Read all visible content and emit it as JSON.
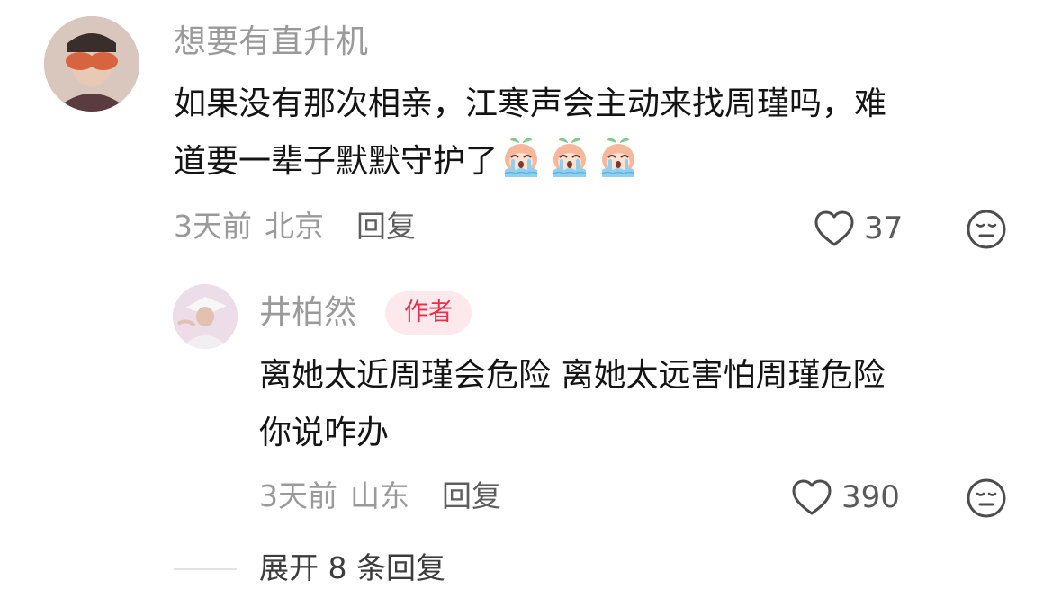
{
  "comment": {
    "username": "想要有直升机",
    "text_line1": "如果没有那次相亲，江寒声会主动来找周瑾吗，难",
    "text_line2": "道要一辈子默默守护了",
    "time": "3天前",
    "location": "北京",
    "reply_label": "回复",
    "likes": "37",
    "emoji": "crying-peach-emoji"
  },
  "reply": {
    "username": "井柏然",
    "badge": "作者",
    "text_line1": "离她太近周瑾会危险 离她太远害怕周瑾危险",
    "text_line2": "你说咋办",
    "time": "3天前",
    "location": "山东",
    "reply_label": "回复",
    "likes": "390"
  },
  "expand_label": "展开 8 条回复",
  "colors": {
    "badge_text": "#e8304c",
    "badge_bg": "#fde8ec",
    "muted": "#9a9a9a"
  }
}
